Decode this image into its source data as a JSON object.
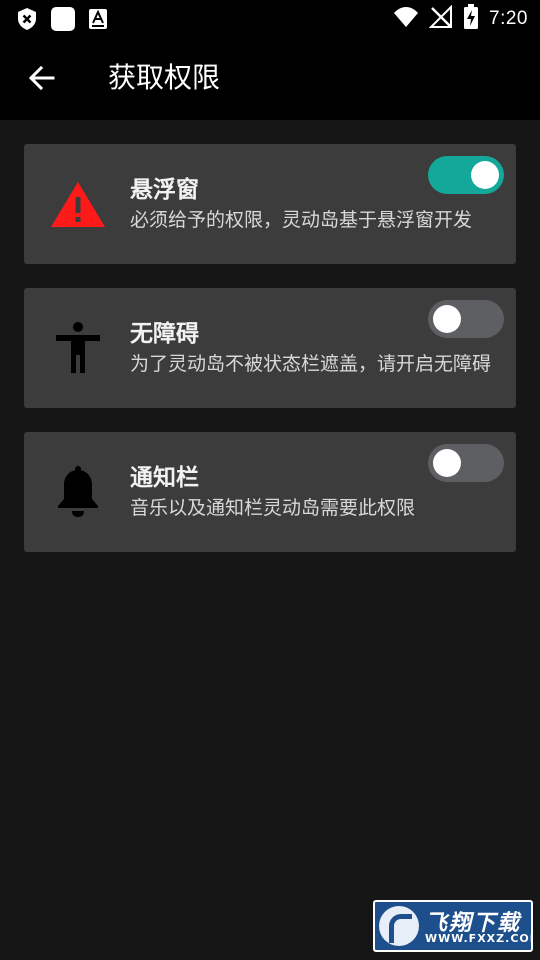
{
  "status_bar": {
    "time": "7:20",
    "icons": [
      "shield-x-icon",
      "square-app-icon",
      "a-app-icon",
      "wifi-icon",
      "no-signal-icon",
      "battery-charging-icon"
    ]
  },
  "app_bar": {
    "title": "获取权限",
    "back_icon": "arrow-left-icon"
  },
  "permissions": [
    {
      "title": "悬浮窗",
      "description": "必须给予的权限，灵动岛基于悬浮窗开发",
      "icon": "warning-triangle-icon",
      "icon_color": "#ff1a1a",
      "enabled": true
    },
    {
      "title": "无障碍",
      "description": "为了灵动岛不被状态栏遮盖，请开启无障碍",
      "icon": "accessibility-person-icon",
      "icon_color": "#000000",
      "enabled": false
    },
    {
      "title": "通知栏",
      "description": "音乐以及通知栏灵动岛需要此权限",
      "icon": "bell-icon",
      "icon_color": "#000000",
      "enabled": false
    }
  ],
  "colors": {
    "toggle_on": "#13a89a",
    "toggle_off": "#5d5f62",
    "card_bg": "#3c3c3c",
    "page_bg": "#161616"
  },
  "watermark": {
    "name": "飞翔下载",
    "url": "WWW.FXXZ.COM"
  }
}
